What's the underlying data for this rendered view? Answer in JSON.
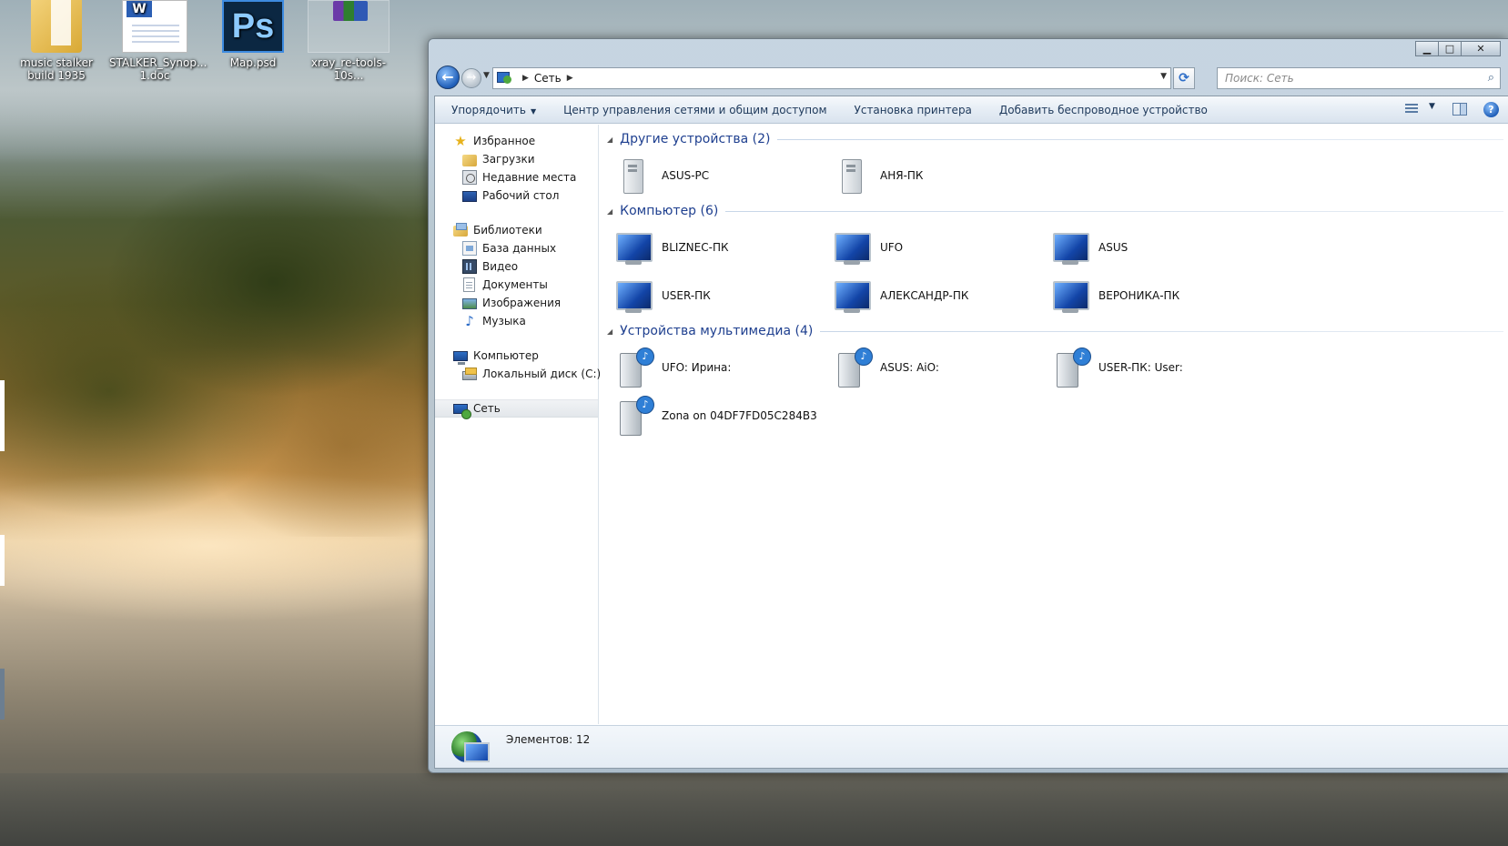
{
  "desktop": {
    "icons": [
      {
        "label": "music stalker build 1935"
      },
      {
        "label": "STALKER_Synop... 1.doc"
      },
      {
        "label": "Map.psd"
      },
      {
        "label": "xray_re-tools-10s..."
      }
    ]
  },
  "window": {
    "controls": {
      "minimize": "▁",
      "maximize": "□",
      "close": "✕"
    },
    "address": {
      "root_label": "Сеть"
    },
    "search": {
      "placeholder": "Поиск: Сеть"
    },
    "toolbar": {
      "organize": "Упорядочить",
      "network_center": "Центр управления сетями и общим доступом",
      "add_printer": "Установка принтера",
      "add_wireless": "Добавить беспроводное устройство",
      "help": "?"
    },
    "sidebar": {
      "favorites": {
        "label": "Избранное",
        "items": [
          {
            "label": "Загрузки"
          },
          {
            "label": "Недавние места"
          },
          {
            "label": "Рабочий стол"
          }
        ]
      },
      "libraries": {
        "label": "Библиотеки",
        "items": [
          {
            "label": "База данных"
          },
          {
            "label": "Видео"
          },
          {
            "label": "Документы"
          },
          {
            "label": "Изображения"
          },
          {
            "label": "Музыка"
          }
        ]
      },
      "computer": {
        "label": "Компьютер",
        "items": [
          {
            "label": "Локальный диск (C:)"
          }
        ]
      },
      "network": {
        "label": "Сеть"
      }
    },
    "groups": [
      {
        "title": "Другие устройства (2)",
        "items": [
          {
            "name": "ASUS-PC",
            "icon": "server-icon"
          },
          {
            "name": "АНЯ-ПК",
            "icon": "server-icon"
          }
        ]
      },
      {
        "title": "Компьютер (6)",
        "items": [
          {
            "name": "BLIZNEC-ПК",
            "icon": "computer-icon"
          },
          {
            "name": "UFO",
            "icon": "computer-icon"
          },
          {
            "name": "ASUS",
            "icon": "computer-icon"
          },
          {
            "name": "USER-ПК",
            "icon": "computer-icon"
          },
          {
            "name": "АЛЕКСАНДР-ПК",
            "icon": "computer-icon"
          },
          {
            "name": "ВЕРОНИКА-ПК",
            "icon": "computer-icon"
          }
        ]
      },
      {
        "title": "Устройства мультимедиа (4)",
        "items": [
          {
            "name": "UFO: Ирина:",
            "icon": "media-device-icon"
          },
          {
            "name": "ASUS: AiO:",
            "icon": "media-device-icon"
          },
          {
            "name": "USER-ПК: User:",
            "icon": "media-device-icon"
          },
          {
            "name": "Zona on 04DF7FD05C284B3",
            "icon": "media-device-icon"
          }
        ]
      }
    ],
    "status": {
      "count_text": "Элементов: 12"
    }
  }
}
